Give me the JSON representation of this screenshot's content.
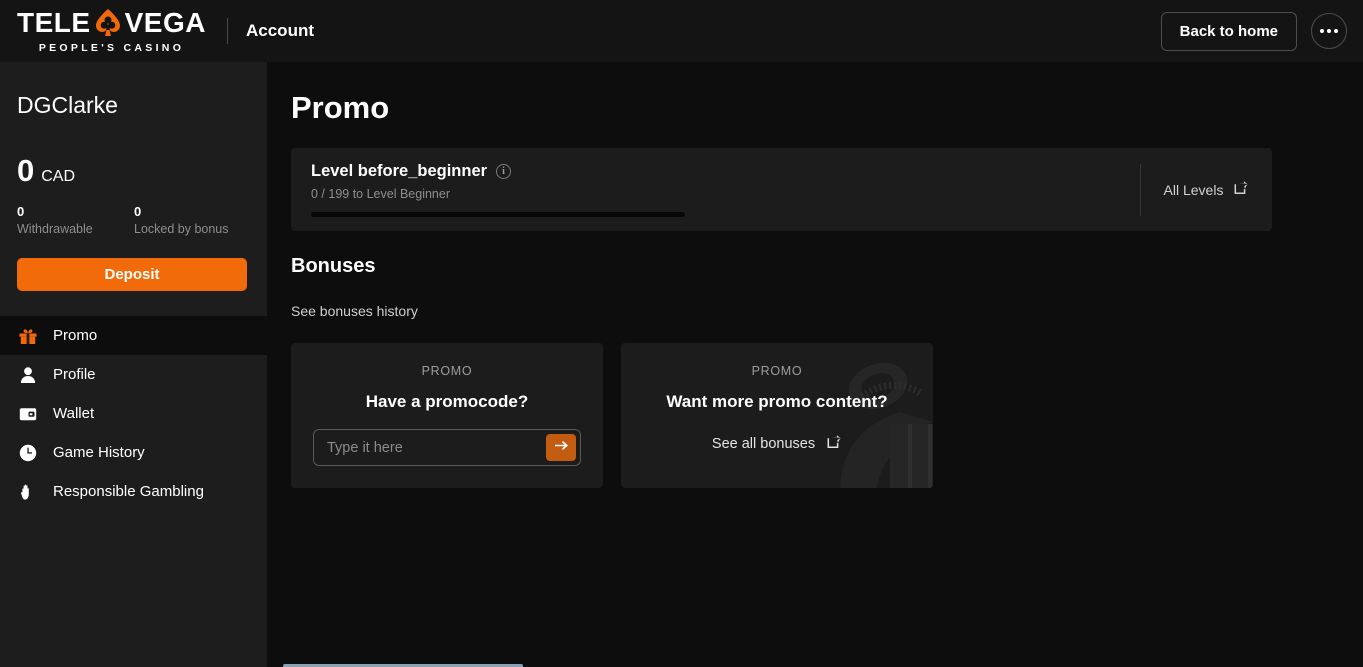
{
  "header": {
    "logo_word_1": "TELE",
    "logo_word_2": "VEGA",
    "logo_icon": "spade-club-icon",
    "logo_tagline": "PEOPLE'S CASINO",
    "title": "Account",
    "back_home_label": "Back to home",
    "more_menu_icon": "ellipsis-icon"
  },
  "sidebar": {
    "username": "DGClarke",
    "balance": {
      "amount": "0",
      "currency": "CAD",
      "withdrawable_value": "0",
      "withdrawable_label": "Withdrawable",
      "locked_value": "0",
      "locked_label": "Locked by bonus"
    },
    "deposit_label": "Deposit",
    "items": [
      {
        "label": "Promo",
        "icon": "gift-icon",
        "active": true
      },
      {
        "label": "Profile",
        "icon": "person-icon",
        "active": false
      },
      {
        "label": "Wallet",
        "icon": "wallet-icon",
        "active": false
      },
      {
        "label": "Game History",
        "icon": "clock-icon",
        "active": false
      },
      {
        "label": "Responsible Gambling",
        "icon": "hand-icon",
        "active": false
      }
    ]
  },
  "main": {
    "page_title": "Promo",
    "level": {
      "name": "Level before_beginner",
      "info_icon": "info-icon",
      "info_glyph": "i",
      "progress_text": "0 / 199 to Level Beginner",
      "progress_percent": 0,
      "all_levels_label": "All Levels",
      "all_levels_icon": "external-link-icon"
    },
    "bonuses": {
      "title": "Bonuses",
      "history_link": "See bonuses history",
      "cards": [
        {
          "kicker": "PROMO",
          "title": "Have a promocode?",
          "input_placeholder": "Type it here",
          "input_value": "",
          "submit_icon": "arrow-right-icon"
        },
        {
          "kicker": "PROMO",
          "title": "Want more promo content?",
          "link_label": "See all bonuses",
          "link_icon": "external-link-icon",
          "art": "gift-ribbon-art"
        }
      ]
    }
  },
  "colors": {
    "accent": "#f26b0a",
    "submit": "#c25c11",
    "header_bg": "#141414",
    "sidebar_bg": "#1d1d1d",
    "main_bg": "#0d0d0d",
    "card_bg": "#1c1c1c"
  }
}
